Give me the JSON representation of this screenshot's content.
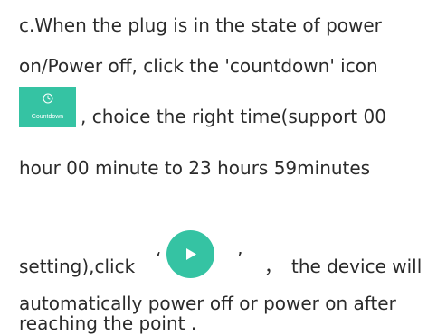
{
  "lines": {
    "l1": "c.When the plug is in the state of power",
    "l2": "on/Power off, click the 'countdown' icon",
    "l3": ", choice the right time(support 00",
    "l4": "hour 00 minute to 23 hours 59minutes",
    "l5_a": "setting),click",
    "l5_q1": "‘",
    "l5_q2": "’",
    "l5_comma": "，",
    "l5_b": "the device will",
    "l6": "automatically power off or power on after",
    "l7": "reaching the point ."
  },
  "countdown_tile": {
    "label": "Countdown",
    "icon": "clock-icon",
    "color": "#35c3a3"
  },
  "play_button": {
    "icon": "play-icon",
    "color": "#35c3a3"
  }
}
